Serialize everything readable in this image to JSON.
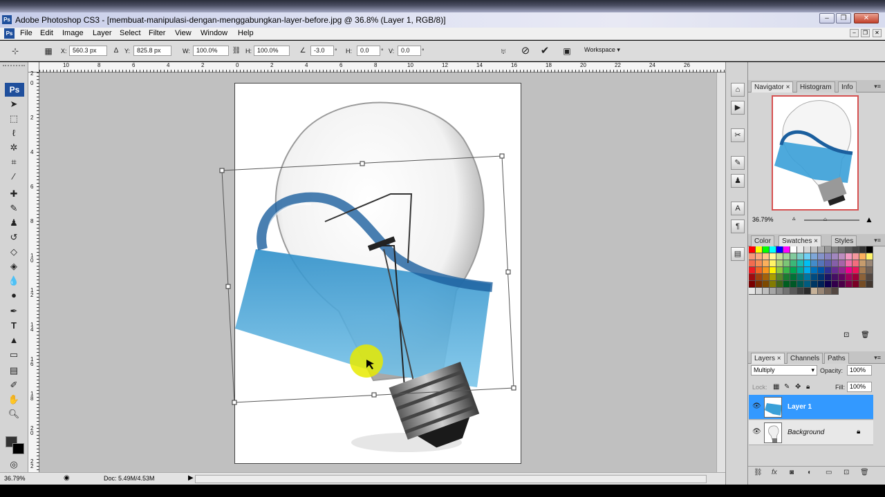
{
  "window": {
    "title": "Adobe Photoshop CS3 - [membuat-manipulasi-dengan-menggabungkan-layer-before.jpg @ 36.8% (Layer 1, RGB/8)]",
    "app_badge": "Ps",
    "min_glyph": "–",
    "max_glyph": "❐",
    "close_glyph": "✕"
  },
  "menubar": {
    "items": [
      "File",
      "Edit",
      "Image",
      "Layer",
      "Select",
      "Filter",
      "View",
      "Window",
      "Help"
    ]
  },
  "options": {
    "x_label": "X:",
    "x_value": "560.3 px",
    "y_label": "Y:",
    "y_value": "825.8 px",
    "w_label": "W:",
    "w_value": "100.0%",
    "h_label": "H:",
    "h_value": "100.0%",
    "angle_value": "-3.0",
    "hskew_label": "H:",
    "hskew_value": "0.0",
    "vskew_label": "V:",
    "vskew_value": "0.0",
    "workspace_label": "Workspace ▾"
  },
  "rulers": {
    "h_labels": [
      "10",
      "8",
      "6",
      "4",
      "2",
      "0",
      "2",
      "4",
      "6",
      "8",
      "10",
      "12",
      "14",
      "16",
      "18",
      "20",
      "22",
      "24",
      "26"
    ],
    "v_labels": [
      "2",
      "0",
      "2",
      "4",
      "6",
      "8",
      "1\n0",
      "1\n2",
      "1\n4",
      "1\n6",
      "1\n8",
      "2\n0",
      "2\n2"
    ]
  },
  "status": {
    "zoom": "36.79%",
    "doc": "Doc: 5.49M/4.53M"
  },
  "navigator": {
    "tabs": [
      "Navigator",
      "Histogram",
      "Info"
    ],
    "zoom": "36.79%"
  },
  "color_panel": {
    "tabs": [
      "Color",
      "Swatches",
      "Styles"
    ],
    "swatch_colors": [
      "#ff0000",
      "#ffff00",
      "#00ff00",
      "#00ffff",
      "#0000ff",
      "#ff00ff",
      "#ffffff",
      "#ebebeb",
      "#d6d6d6",
      "#c2c2c2",
      "#adadad",
      "#999999",
      "#858585",
      "#707070",
      "#5c5c5c",
      "#474747",
      "#333333",
      "#000000",
      "#f7977a",
      "#f9ad81",
      "#fdc68a",
      "#fff79a",
      "#c4df9b",
      "#a2d39c",
      "#82ca9d",
      "#7bcdc8",
      "#6ecff6",
      "#7ea7d8",
      "#8493ca",
      "#8882be",
      "#a187be",
      "#bc8dbf",
      "#f49ac2",
      "#f6989d",
      "#fbaf5d",
      "#fff468",
      "#f26c4f",
      "#f68e55",
      "#fbaf5c",
      "#fff467",
      "#acd372",
      "#7cc576",
      "#3bb878",
      "#1abbb4",
      "#00bff3",
      "#438cca",
      "#5574b9",
      "#605ca8",
      "#855fa8",
      "#a763a8",
      "#f06ea9",
      "#f26d7d",
      "#c69c6d",
      "#998675",
      "#ed1c24",
      "#f26522",
      "#f7941d",
      "#fff200",
      "#8dc73f",
      "#39b54a",
      "#00a651",
      "#00a99d",
      "#00aeef",
      "#0072bc",
      "#0054a6",
      "#2e3192",
      "#662d91",
      "#92278f",
      "#ec008c",
      "#ed145b",
      "#a67c52",
      "#736357",
      "#9e0b0f",
      "#a0410d",
      "#a36209",
      "#aba000",
      "#598527",
      "#1a7b30",
      "#007236",
      "#00746b",
      "#0076a3",
      "#004b80",
      "#003471",
      "#1b1464",
      "#440e62",
      "#630460",
      "#9e005d",
      "#9e0039",
      "#8c6239",
      "#534741",
      "#790000",
      "#7b2e00",
      "#7d4900",
      "#827b00",
      "#406618",
      "#005e20",
      "#005826",
      "#005952",
      "#005b7f",
      "#003663",
      "#002157",
      "#0d004c",
      "#32004b",
      "#4b0049",
      "#7b0046",
      "#7a0026",
      "#754c24",
      "#42372f",
      "#e6e6e6",
      "#d2d2d2",
      "#bfbfbf",
      "#a6a6a6",
      "#8c8c8c",
      "#737373",
      "#595959",
      "#404040",
      "#2b2b2b",
      "#c7b299",
      "#998675",
      "#736357",
      "#534741"
    ]
  },
  "layers": {
    "tabs": [
      "Layers",
      "Channels",
      "Paths"
    ],
    "blend_mode": "Multiply",
    "opacity_label": "Opacity:",
    "opacity_value": "100%",
    "lock_label": "Lock:",
    "fill_label": "Fill:",
    "fill_value": "100%",
    "rows": [
      {
        "name": "Layer 1"
      },
      {
        "name": "Background"
      }
    ]
  }
}
